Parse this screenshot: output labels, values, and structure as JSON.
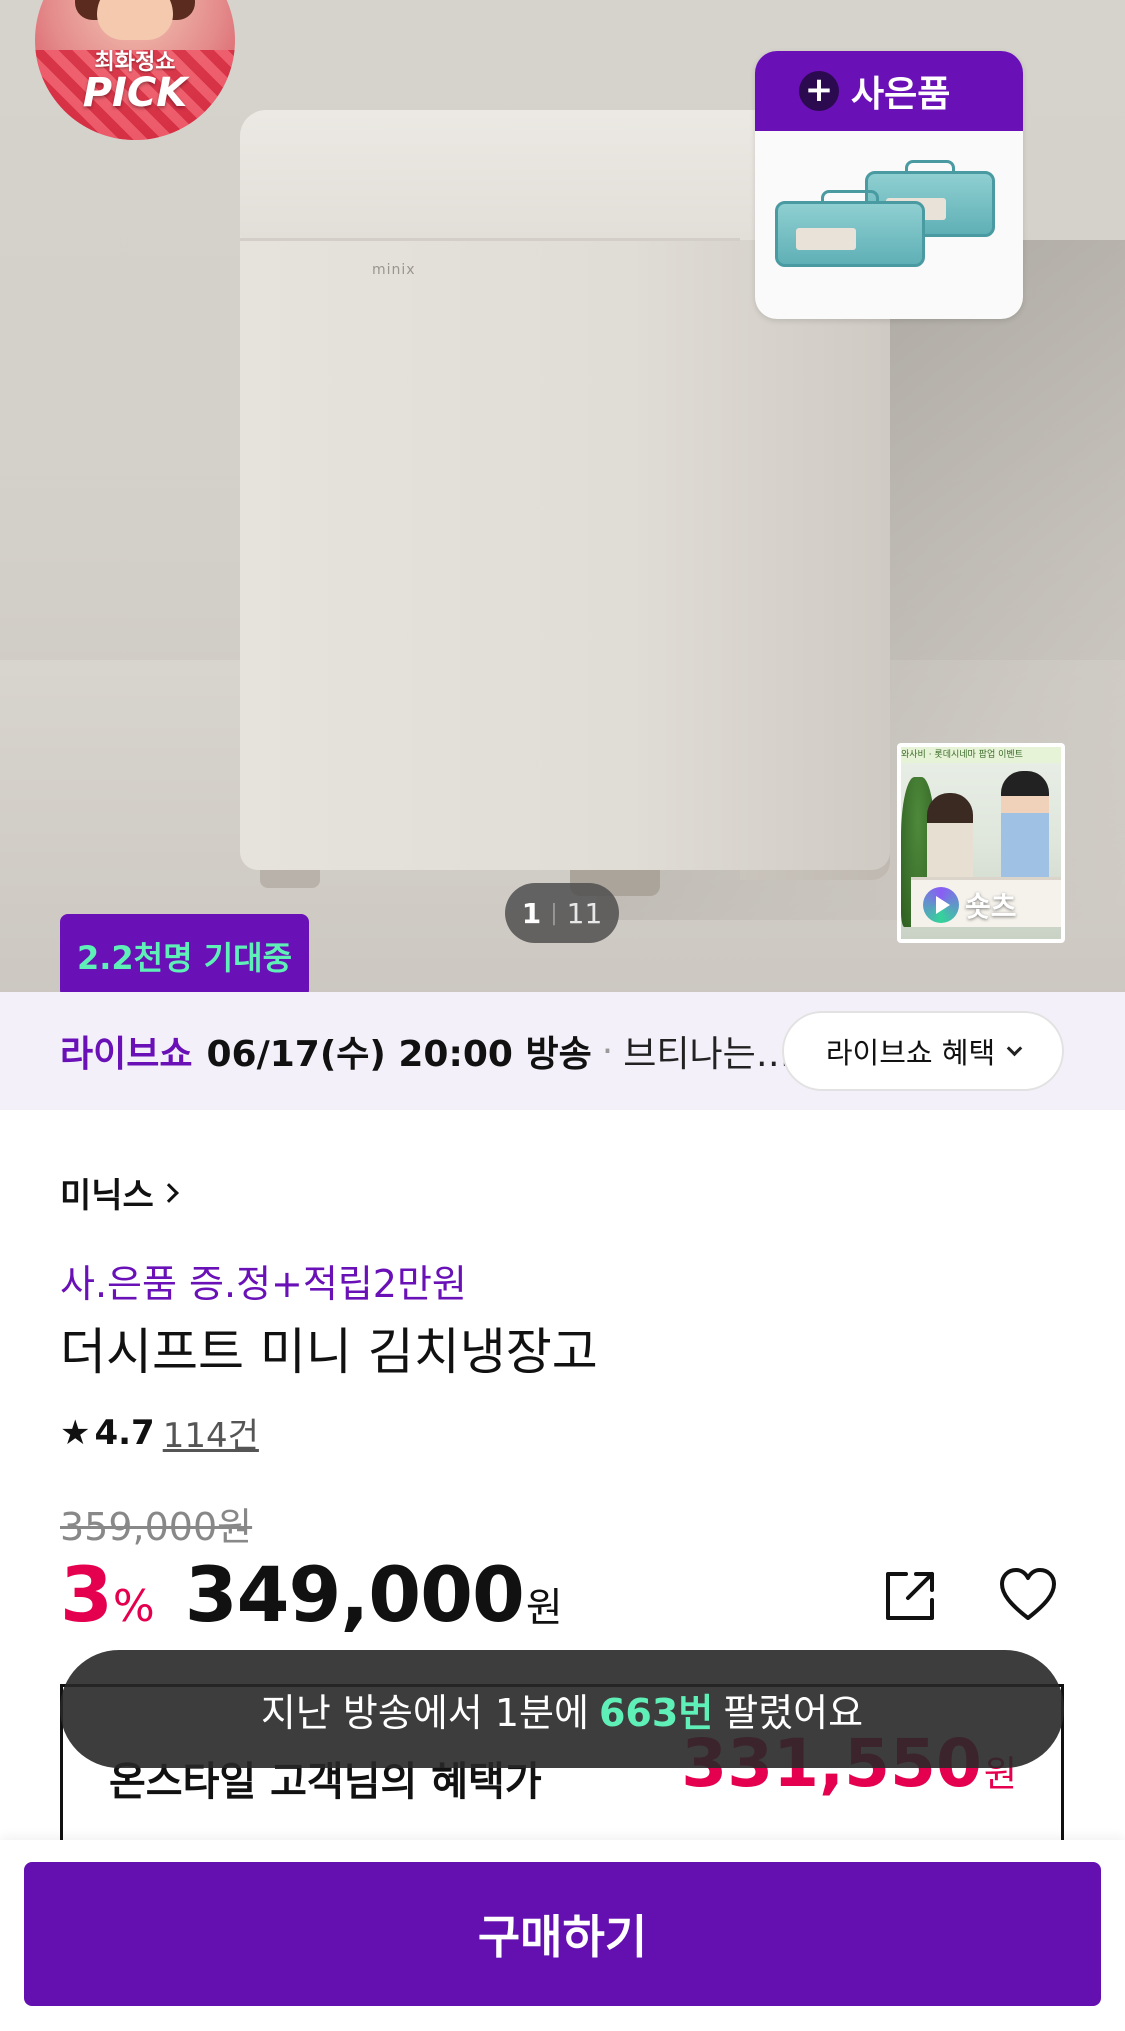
{
  "hero": {
    "pick_badge": {
      "line1": "최화정쇼",
      "line2": "PICK"
    },
    "product_brand_mark": "minix",
    "gift_card": {
      "title": "사은품",
      "plus_icon": "plus-icon"
    },
    "image_counter": {
      "current": "1",
      "separator": "|",
      "total": "11"
    },
    "shorts": {
      "label": "숏츠",
      "banner": "와사비 · 롯데시네마 팝업 이벤트",
      "icon": "play-icon"
    },
    "expect_badge": "2.2천명 기대중"
  },
  "live": {
    "label": "라이브쇼",
    "schedule": "06/17(수) 20:00 방송",
    "dot": "·",
    "description": "브티나는 …",
    "benefit_button": "라이브쇼 혜택",
    "chevron_icon": "chevron-down-icon"
  },
  "product": {
    "brand": "미닉스",
    "promo": "사.은품 증.정+적립2만원",
    "title": "더시프트 미니 김치냉장고",
    "rating": {
      "star_icon": "★",
      "score": "4.7",
      "review_count": "114건"
    },
    "original_price": "359,000원",
    "discount_rate": "3",
    "discount_unit": "%",
    "sale_price": "349,000",
    "currency": "원",
    "share_icon": "share-icon",
    "like_icon": "heart-icon"
  },
  "benefit": {
    "label": "온스타일 고객님의 혜택가",
    "price": "331,550",
    "currency": "원"
  },
  "toast": {
    "prefix": "지난 방송에서 1분에",
    "highlight": "663번",
    "suffix": "팔렸어요"
  },
  "bottom": {
    "buy_label": "구매하기"
  },
  "colors": {
    "brand_purple": "#6910b7",
    "sale_red": "#e5004f",
    "mint": "#5ff0b8"
  }
}
